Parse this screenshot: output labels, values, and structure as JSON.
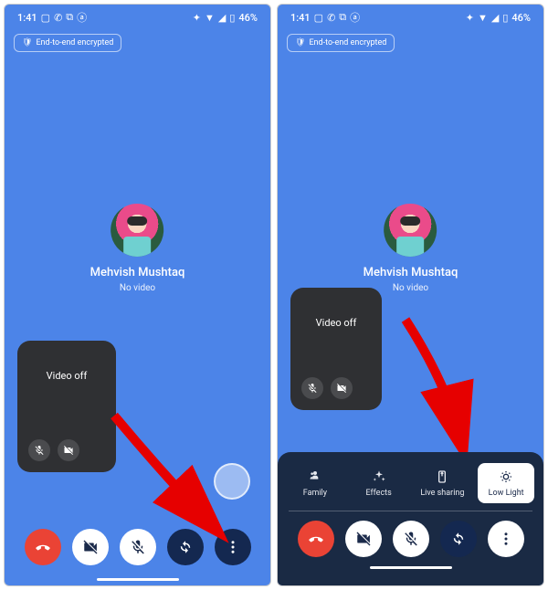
{
  "status": {
    "time": "1:41",
    "battery": "46%"
  },
  "chip": {
    "label": "End-to-end encrypted"
  },
  "contact": {
    "name": "Mehvish Mushtaq",
    "sub": "No video"
  },
  "pip": {
    "label": "Video off"
  },
  "panel": {
    "items": {
      "family": "Family",
      "effects": "Effects",
      "live": "Live sharing",
      "lowlight": "Low Light"
    }
  }
}
